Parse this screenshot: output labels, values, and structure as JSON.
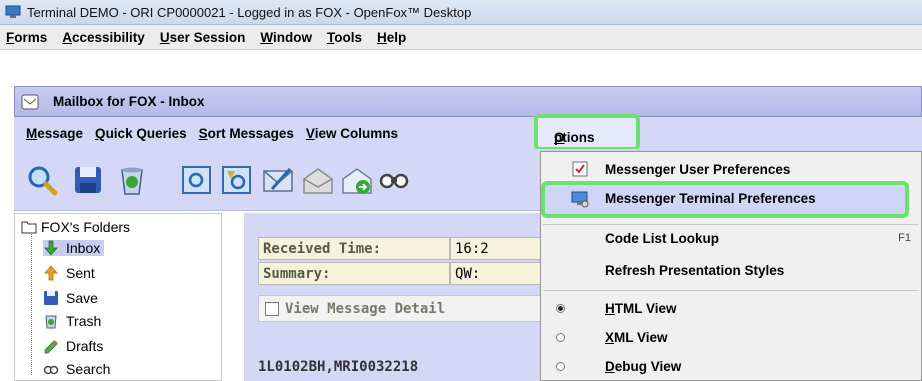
{
  "window": {
    "title": "Terminal DEMO - ORI CP0000021 - Logged in as FOX - OpenFox™ Desktop"
  },
  "menubar": [
    {
      "mn": "F",
      "rest": "orms"
    },
    {
      "mn": "A",
      "rest": "ccessibility"
    },
    {
      "mn": "U",
      "rest": "ser Session"
    },
    {
      "mn": "W",
      "rest": "indow"
    },
    {
      "mn": "T",
      "rest": "ools"
    },
    {
      "mn": "H",
      "rest": "elp"
    }
  ],
  "frame": {
    "title": "Mailbox for FOX - Inbox",
    "menus": [
      {
        "mn": "M",
        "rest": "essage"
      },
      {
        "mn": "Q",
        "rest": "uick Queries"
      },
      {
        "mn": "S",
        "rest": "ort Messages"
      },
      {
        "mn": "V",
        "rest": "iew Columns"
      }
    ],
    "options_menu": {
      "mn": "O",
      "rest": "ptions"
    }
  },
  "toolbar_icons": [
    "search-icon",
    "save-icon",
    "trash-icon",
    "view-message-icon",
    "open-message-icon",
    "compose-icon",
    "forward-icon",
    "reply-icon",
    "binoculars-icon"
  ],
  "tree": {
    "root": "FOX's Folders",
    "items": [
      "Inbox",
      "Sent",
      "Save",
      "Trash",
      "Drafts",
      "Search"
    ]
  },
  "detail": {
    "received_label": "Received Time:",
    "received_value": "16:2",
    "summary_label": "Summary:",
    "summary_value": "QW:",
    "view_details": "View Message Detail",
    "body_line": "1L0102BH,MRI0032218"
  },
  "options_dropdown": {
    "user_prefs": "Messenger User Preferences",
    "terminal_prefs": "Messenger Terminal Preferences",
    "code_list": "Code List Lookup",
    "code_list_accel": "F1",
    "refresh": "Refresh Presentation Styles",
    "html_view": {
      "mn": "H",
      "rest": "TML View"
    },
    "xml_view": {
      "mn": "X",
      "rest": "ML View"
    },
    "debug_view": {
      "mn": "D",
      "rest": "ebug View"
    },
    "selected_view": "HTML View"
  },
  "colors": {
    "frame_bg": "#d4d8f6",
    "highlight_green": "#6ee06e",
    "field_bg": "#f5f3dc"
  }
}
